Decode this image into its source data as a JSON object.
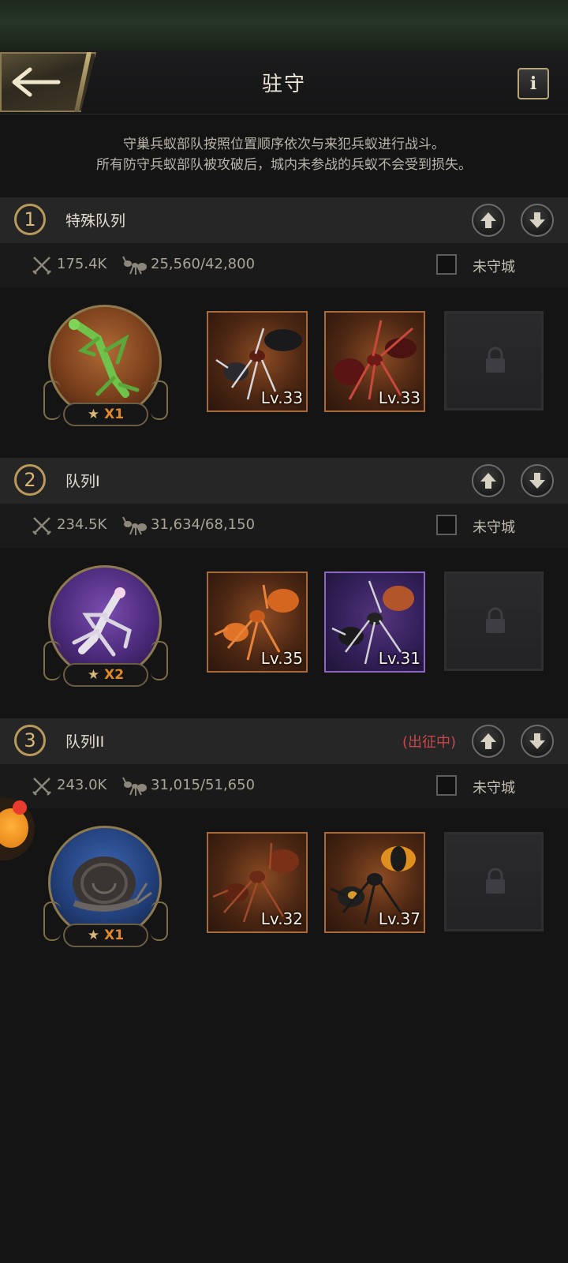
{
  "header": {
    "title": "驻守",
    "info_label": "i"
  },
  "description": [
    "守巢兵蚁部队按照位置顺序依次与来犯兵蚁进行战斗。",
    "所有防守兵蚁部队被攻破后，城内未参战的兵蚁不会受到损失。"
  ],
  "squads": [
    {
      "number": "1",
      "name": "特殊队列",
      "status": "",
      "power": "175.4K",
      "troops": "25,560/42,800",
      "garrison_label": "未守城",
      "leader": {
        "species": "green-mantis-icon",
        "color": "#9a5a2c",
        "stars": "X1"
      },
      "units": [
        {
          "level": "Lv.33",
          "style": "orange"
        },
        {
          "level": "Lv.33",
          "style": "orange"
        }
      ]
    },
    {
      "number": "2",
      "name": "队列I",
      "status": "",
      "power": "234.5K",
      "troops": "31,634/68,150",
      "garrison_label": "未守城",
      "leader": {
        "species": "orchid-mantis-icon",
        "color": "#5a2d8c",
        "stars": "X2"
      },
      "units": [
        {
          "level": "Lv.35",
          "style": "orange"
        },
        {
          "level": "Lv.31",
          "style": "purple"
        }
      ]
    },
    {
      "number": "3",
      "name": "队列II",
      "status": "(出征中)",
      "power": "243.0K",
      "troops": "31,015/51,650",
      "garrison_label": "未守城",
      "leader": {
        "species": "snail-icon",
        "color": "#22407a",
        "stars": "X1"
      },
      "units": [
        {
          "level": "Lv.32",
          "style": "orange"
        },
        {
          "level": "Lv.37",
          "style": "orange"
        }
      ]
    }
  ]
}
